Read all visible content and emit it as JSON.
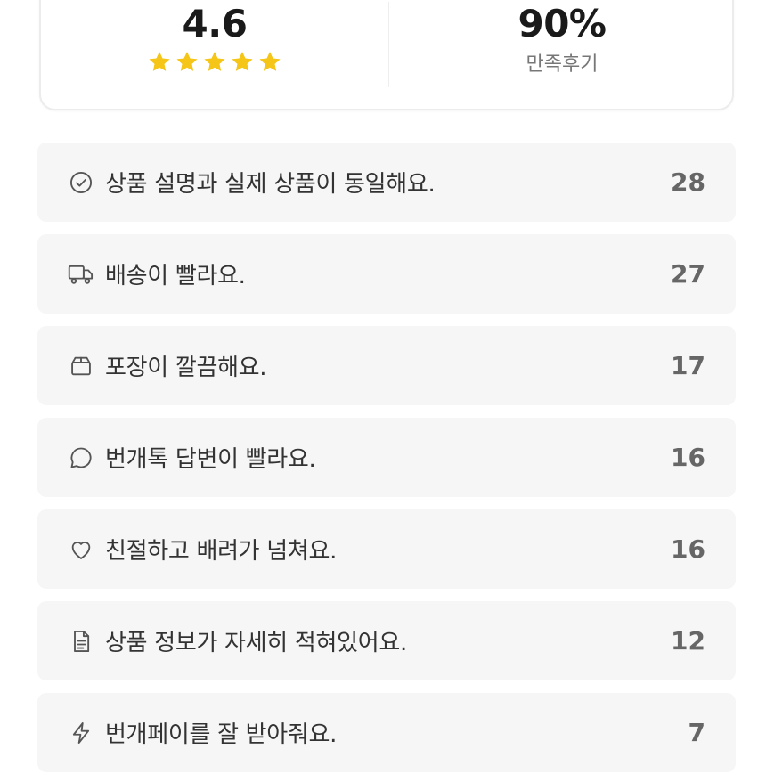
{
  "summary": {
    "rating_value": "4.6",
    "rating_stars": 5,
    "satisfaction_value": "90%",
    "satisfaction_label": "만족후기",
    "star_color": "#F5C518"
  },
  "reasons": [
    {
      "icon": "check-circle-icon",
      "label": "상품 설명과 실제 상품이 동일해요.",
      "count": "28"
    },
    {
      "icon": "truck-icon",
      "label": "배송이 빨라요.",
      "count": "27"
    },
    {
      "icon": "box-icon",
      "label": "포장이 깔끔해요.",
      "count": "17"
    },
    {
      "icon": "chat-bubble-icon",
      "label": "번개톡 답변이 빨라요.",
      "count": "16"
    },
    {
      "icon": "heart-icon",
      "label": "친절하고 배려가 넘쳐요.",
      "count": "16"
    },
    {
      "icon": "document-icon",
      "label": "상품 정보가 자세히 적혀있어요.",
      "count": "12"
    },
    {
      "icon": "lightning-icon",
      "label": "번개페이를 잘 받아줘요.",
      "count": "7"
    }
  ]
}
